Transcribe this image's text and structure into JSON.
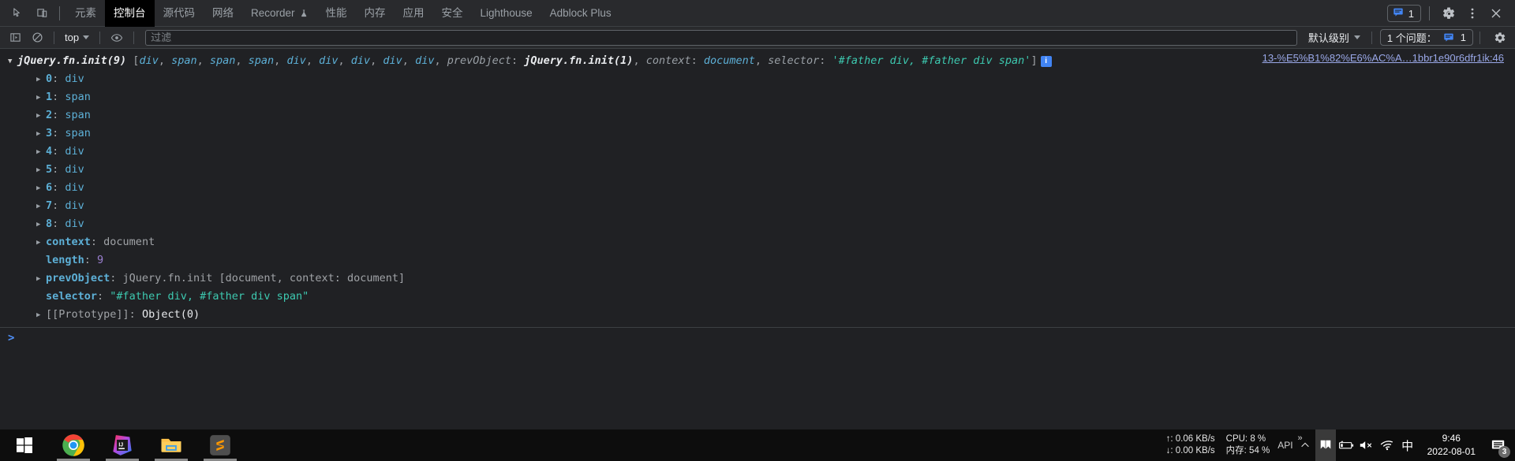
{
  "devtools": {
    "toolbar_icons": [
      {
        "name": "inspect-element-icon",
        "label": "Inspect"
      },
      {
        "name": "device-toolbar-icon",
        "label": "Toggle device toolbar"
      }
    ],
    "tabs": [
      {
        "id": "elements",
        "label": "元素",
        "active": false,
        "icon": null
      },
      {
        "id": "console",
        "label": "控制台",
        "active": true,
        "icon": null
      },
      {
        "id": "sources",
        "label": "源代码",
        "active": false,
        "icon": null
      },
      {
        "id": "network",
        "label": "网络",
        "active": false,
        "icon": null
      },
      {
        "id": "recorder",
        "label": "Recorder",
        "active": false,
        "icon": "flask-icon"
      },
      {
        "id": "performance",
        "label": "性能",
        "active": false,
        "icon": null
      },
      {
        "id": "memory",
        "label": "内存",
        "active": false,
        "icon": null
      },
      {
        "id": "application",
        "label": "应用",
        "active": false,
        "icon": null
      },
      {
        "id": "security",
        "label": "安全",
        "active": false,
        "icon": null
      },
      {
        "id": "lighthouse",
        "label": "Lighthouse",
        "active": false,
        "icon": null
      },
      {
        "id": "adblock",
        "label": "Adblock Plus",
        "active": false,
        "icon": null
      }
    ],
    "tabbar_right": {
      "issue_count": "1",
      "settings_label": "设置",
      "more_label": "更多选项",
      "close_label": "关闭"
    },
    "filterbar": {
      "sidebar_toggle": "console-sidebar-icon",
      "clear_label": "清除控制台",
      "context": "top",
      "eye_label": "实时表达式",
      "filter_placeholder": "过滤",
      "filter_value": "",
      "level": "默认级别",
      "issues_text": "1 个问题：",
      "issues_count": "1",
      "settings_label": "控制台设置"
    }
  },
  "console": {
    "source_link": "13-%E5%B1%82%E6%AC%A…1bbr1e90r6dfr1ik:46",
    "header": {
      "constructor": "jQuery.fn.init(9)",
      "open_bracket": " [",
      "nodes": [
        "div",
        "span",
        "span",
        "span",
        "div",
        "div",
        "div",
        "div",
        "div"
      ],
      "prev_key": "prevObject",
      "prev_val": "jQuery.fn.init(1)",
      "context_key": "context",
      "context_val": "document",
      "selector_key": "selector",
      "selector_val": "'#father div, #father div span'",
      "close_bracket": "]",
      "info_badge": "i"
    },
    "entries": [
      {
        "key": "0",
        "sep": ": ",
        "value": "div",
        "kind": "index"
      },
      {
        "key": "1",
        "sep": ": ",
        "value": "span",
        "kind": "index"
      },
      {
        "key": "2",
        "sep": ": ",
        "value": "span",
        "kind": "index"
      },
      {
        "key": "3",
        "sep": ": ",
        "value": "span",
        "kind": "index"
      },
      {
        "key": "4",
        "sep": ": ",
        "value": "div",
        "kind": "index"
      },
      {
        "key": "5",
        "sep": ": ",
        "value": "div",
        "kind": "index"
      },
      {
        "key": "6",
        "sep": ": ",
        "value": "div",
        "kind": "index"
      },
      {
        "key": "7",
        "sep": ": ",
        "value": "div",
        "kind": "index"
      },
      {
        "key": "8",
        "sep": ": ",
        "value": "div",
        "kind": "index"
      },
      {
        "key": "context",
        "sep": ": ",
        "value": "document",
        "kind": "prop-gray"
      },
      {
        "key": "length",
        "sep": ": ",
        "value": "9",
        "kind": "number",
        "no_arrow": true
      },
      {
        "key": "prevObject",
        "sep": ": ",
        "value": "jQuery.fn.init [document, context: document]",
        "kind": "prev"
      },
      {
        "key": "selector",
        "sep": ": ",
        "value": "\"#father div, #father div span\"",
        "kind": "string",
        "no_arrow": true
      },
      {
        "key": "[[Prototype]]",
        "sep": ": ",
        "value": "Object(0)",
        "kind": "proto"
      }
    ],
    "prompt": ">"
  },
  "taskbar": {
    "apps": [
      {
        "name": "start-button",
        "icon": "windows-logo-icon",
        "running": false
      },
      {
        "name": "taskbar-app-chrome",
        "icon": "chrome-icon",
        "running": true
      },
      {
        "name": "taskbar-app-intellij",
        "icon": "intellij-idea-icon",
        "running": true
      },
      {
        "name": "taskbar-app-explorer",
        "icon": "file-explorer-icon",
        "running": true
      },
      {
        "name": "taskbar-app-sublime",
        "icon": "sublime-text-icon",
        "running": true
      }
    ],
    "net_up": "↑: 0.06 KB/s",
    "net_down": "↓: 0.00 KB/s",
    "cpu": "CPU: 8 %",
    "mem": "内存: 54 %",
    "api_label": "API",
    "tray": {
      "overflow": "show-hidden-icons",
      "items": [
        {
          "name": "tray-app-icon",
          "glyph": "flag"
        },
        {
          "name": "battery-icon",
          "glyph": "battery"
        },
        {
          "name": "volume-muted-icon",
          "glyph": "speaker-mute"
        },
        {
          "name": "wifi-icon",
          "glyph": "wifi"
        },
        {
          "name": "ime-indicator",
          "glyph": "中"
        }
      ]
    },
    "clock_time": "9:46",
    "clock_date": "2022-08-01",
    "notification_count": "3"
  },
  "colors": {
    "accent": "#4285f4",
    "tab_active_bg": "#000000",
    "panel_bg": "#202124",
    "toolbar_bg": "#292a2d",
    "node_blue": "#5db0d7",
    "string_green": "#3dc9b0",
    "number_purple": "#9a7fd0",
    "link_blue": "#9aa8e8"
  }
}
